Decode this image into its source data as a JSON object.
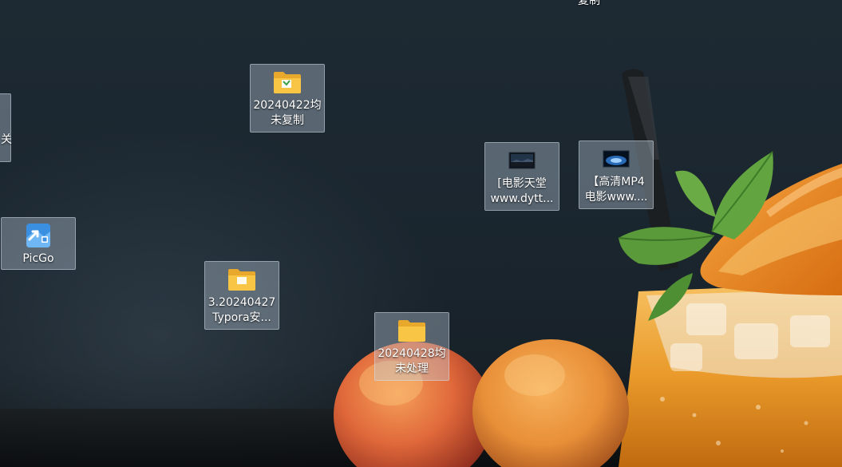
{
  "desktop": {
    "icons": [
      {
        "name": "folder-20240422",
        "icon": "folder-icon",
        "lines": [
          "20240422均",
          "未复制"
        ]
      },
      {
        "name": "picgo",
        "icon": "picgo-icon",
        "lines": [
          "PicGo"
        ]
      },
      {
        "name": "folder-3-20240427",
        "icon": "folder-icon",
        "lines": [
          "3.20240427",
          "Typora安..."
        ]
      },
      {
        "name": "folder-20240428",
        "icon": "folder-icon",
        "lines": [
          "20240428均",
          "未处理"
        ]
      },
      {
        "name": "video-dytt",
        "icon": "video-thumbnail-icon",
        "lines": [
          "[电影天堂",
          "www.dytt..."
        ]
      },
      {
        "name": "video-hd-mp4",
        "icon": "video-thumbnail-icon",
        "lines": [
          "【高清MP4",
          "电影www...."
        ]
      }
    ],
    "partial_left_label": "关",
    "partial_top_label": "复制"
  },
  "colors": {
    "folder_yellow": "#f8c544",
    "folder_back": "#e8a82c",
    "picgo_blue": "#3b8fe0",
    "selection_bg": "#bccddc"
  }
}
